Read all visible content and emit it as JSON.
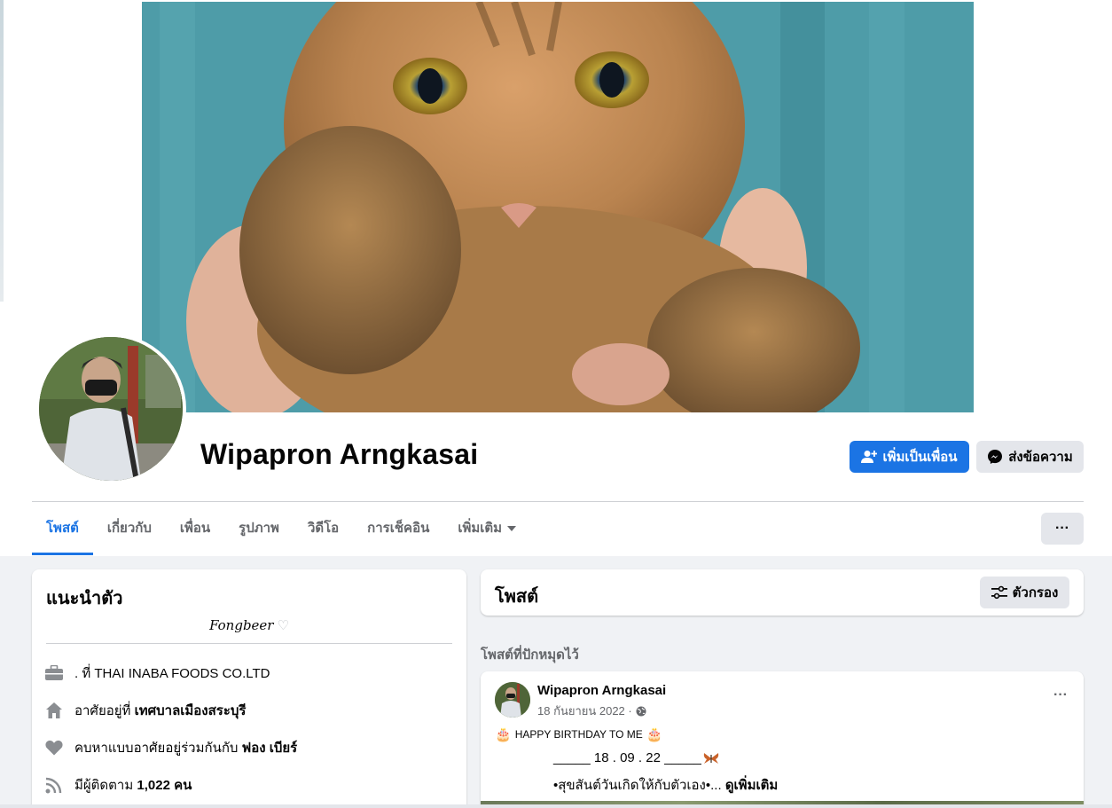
{
  "profile": {
    "name": "Wipapron Arngkasai"
  },
  "actions": {
    "add_friend": "เพิ่มเป็นเพื่อน",
    "message": "ส่งข้อความ",
    "more": "···"
  },
  "tabs": [
    {
      "label": "โพสต์",
      "active": true
    },
    {
      "label": "เกี่ยวกับ",
      "active": false
    },
    {
      "label": "เพื่อน",
      "active": false
    },
    {
      "label": "รูปภาพ",
      "active": false
    },
    {
      "label": "วิดีโอ",
      "active": false
    },
    {
      "label": "การเช็คอิน",
      "active": false
    },
    {
      "label": "เพิ่มเติม",
      "active": false
    }
  ],
  "intro": {
    "title": "แนะนำตัว",
    "bio": "Fongbeer",
    "work": ". ที่ THAI INABA FOODS CO.LTD",
    "lives_prefix": "อาศัยอยู่ที่ ",
    "lives_place": "เทศบาลเมืองสระบุรี",
    "relationship_prefix": "คบหาแบบอาศัยอยู่ร่วมกันกับ ",
    "relationship_partner": "ฟอง เบียร์",
    "followers_prefix": "มีผู้ติดตาม ",
    "followers_count": "1,022 คน"
  },
  "posts": {
    "title": "โพสต์",
    "filter": "ตัวกรอง",
    "pinned_label": "โพสต์ที่ปักหมุดไว้"
  },
  "post": {
    "author": "Wipapron Arngkasai",
    "date": "18 กันยายน 2022 ·",
    "line1": "HAPPY BIRTHDAY TO ME",
    "line2": "_____ 18 . 09 . 22 _____",
    "line3": "•สุขสันต์วันเกิดให้กับตัวเอง•... ",
    "see_more": "ดูเพิ่มเติม",
    "more": "···"
  },
  "colors": {
    "accent": "#1b74e4",
    "background": "#f0f2f5",
    "secondary_button": "#e4e6eb",
    "muted_text": "#65676b"
  },
  "icons": [
    "add-friend-icon",
    "messenger-icon",
    "briefcase-icon",
    "home-icon",
    "heart-icon",
    "rss-icon",
    "filter-icon",
    "globe-icon",
    "cake-icon",
    "butterfly-icon",
    "dropdown-caret-icon",
    "more-dots-icon"
  ]
}
